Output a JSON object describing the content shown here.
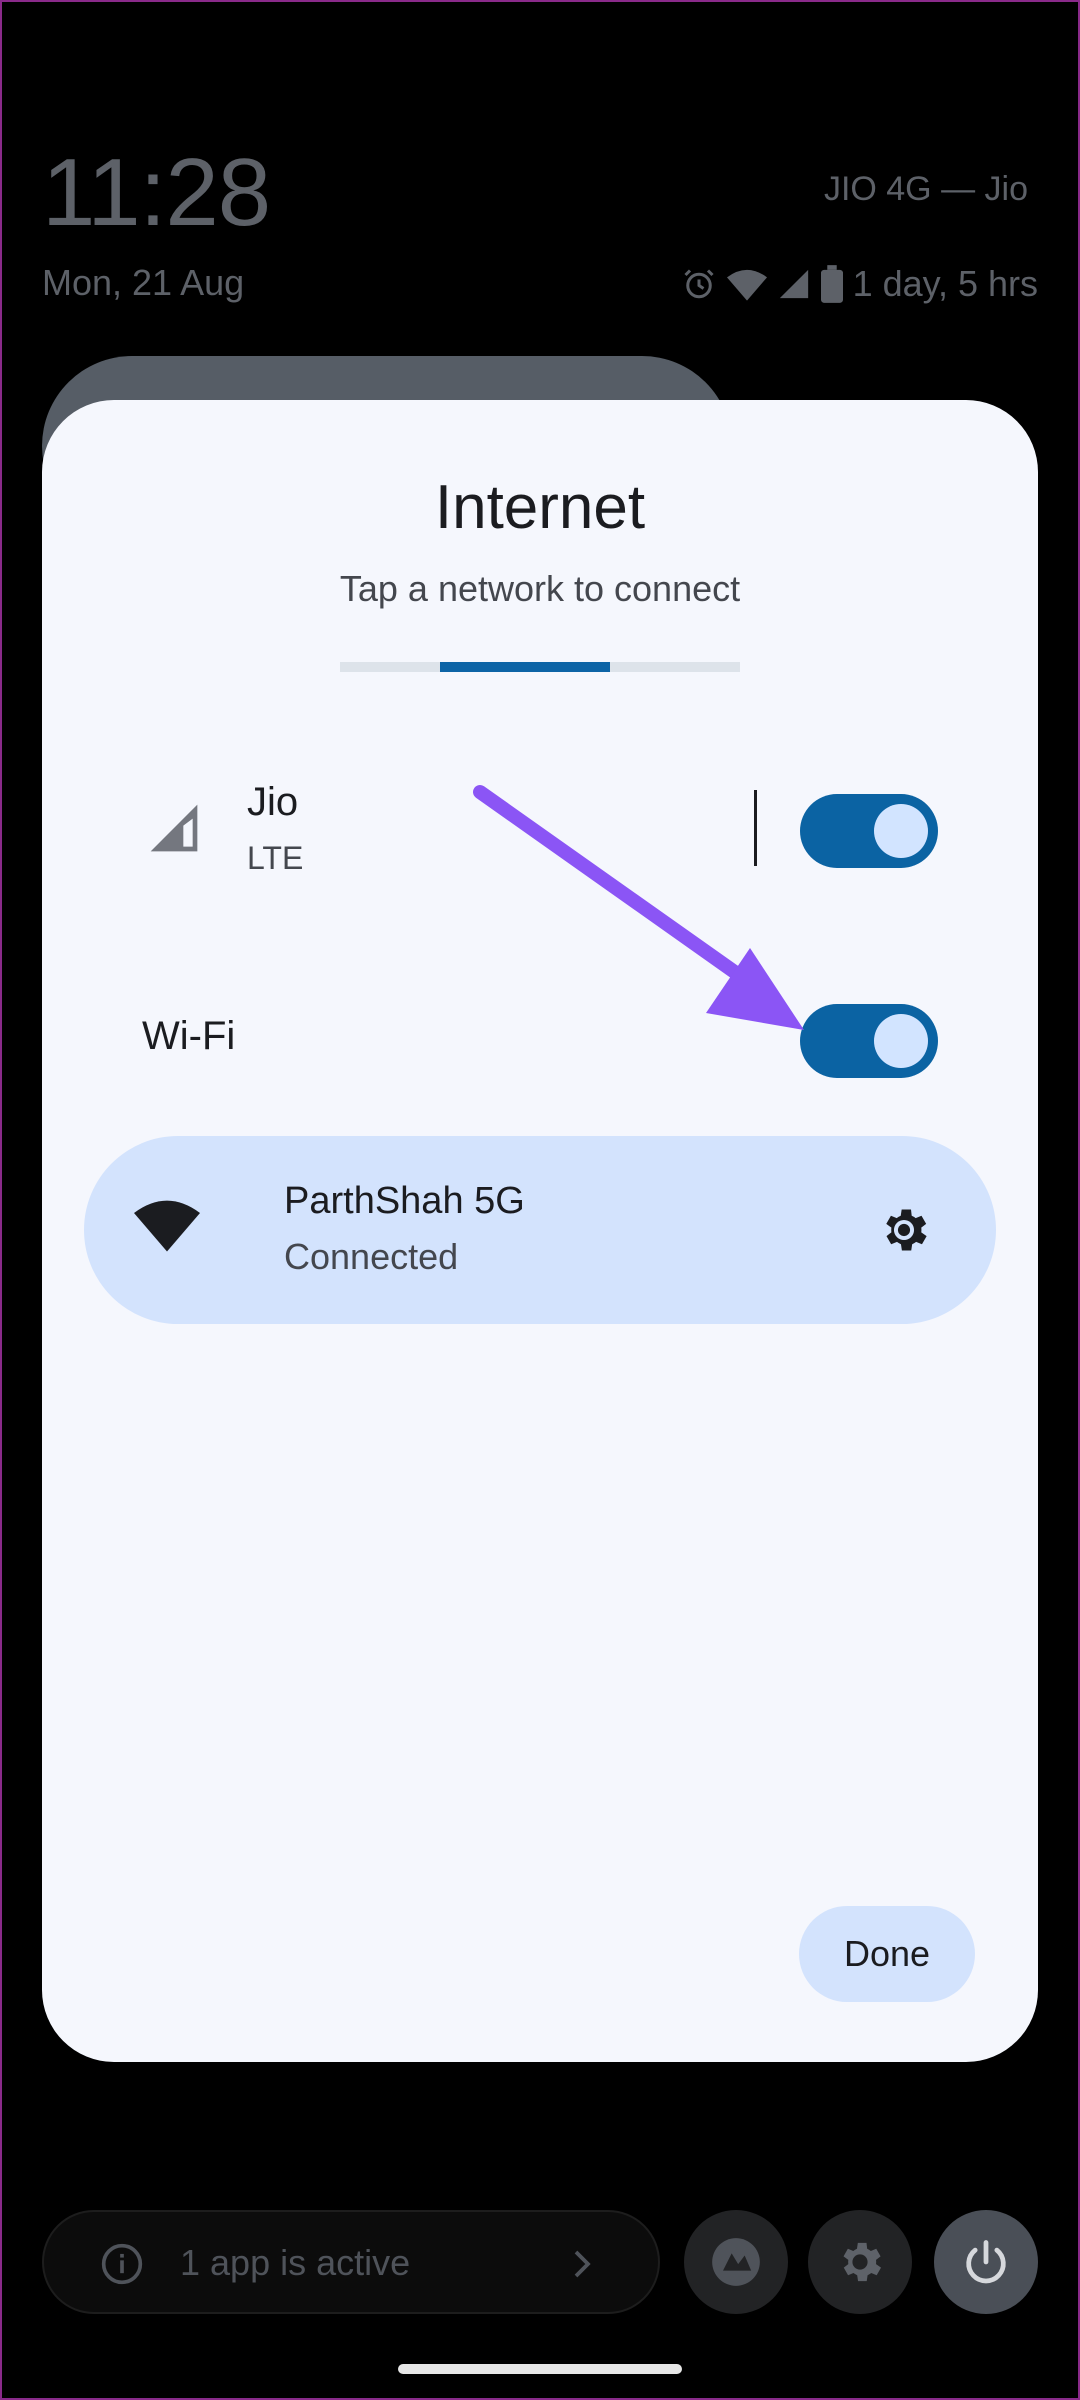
{
  "status": {
    "time": "11:28",
    "date": "Mon, 21 Aug",
    "carrier": "JIO 4G — Jio",
    "battery": "1 day, 5 hrs",
    "icons": [
      "alarm-icon",
      "wifi-icon",
      "cell-signal-icon",
      "battery-icon"
    ]
  },
  "dialog": {
    "title": "Internet",
    "subtitle": "Tap a network to connect",
    "mobile": {
      "name": "Jio",
      "type": "LTE",
      "enabled": true
    },
    "wifi": {
      "label": "Wi-Fi",
      "enabled": true
    },
    "network": {
      "name": "ParthShah 5G",
      "status": "Connected"
    },
    "done_label": "Done"
  },
  "bottom": {
    "active_apps": "1 app is active"
  },
  "colors": {
    "accent": "#0b63a3",
    "card": "#d3e3fd",
    "dialog_bg": "#f5f7fd",
    "annotation_arrow": "#8b55f5"
  }
}
